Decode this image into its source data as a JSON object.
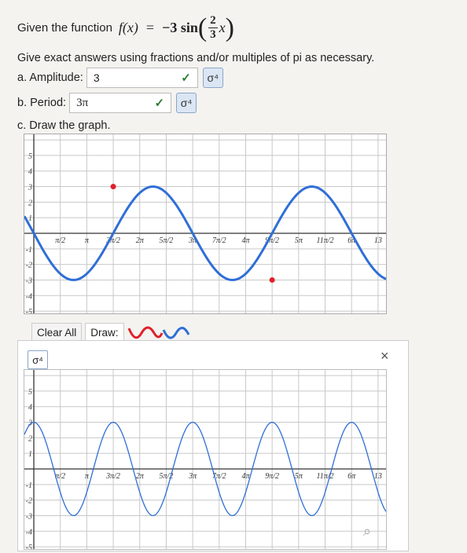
{
  "question": {
    "prefix": "Given the function",
    "func_name": "f(x)",
    "equals": "=",
    "coeff": "−3 sin",
    "frac_num": "2",
    "frac_den": "3",
    "var": "x",
    "lparen": "(",
    "rparen": ")"
  },
  "instructions": "Give exact answers using fractions and/or multiples of pi as necessary.",
  "amplitude": {
    "label": "a. Amplitude:",
    "value": "3",
    "check": "✓"
  },
  "period": {
    "label": "b. Period:",
    "value": "3π",
    "check": "✓"
  },
  "part_c_label": "c. Draw the graph.",
  "graph": {
    "x_tick_labels": [
      "π/2",
      "π",
      "3π/2",
      "2π",
      "5π/2",
      "3π",
      "7π/2",
      "4π",
      "9π/2",
      "5π",
      "11π/2",
      "6π",
      "13"
    ],
    "y_tick_labels": [
      "5",
      "4",
      "3",
      "2",
      "1",
      "-1",
      "-2",
      "-3",
      "-4",
      "-5"
    ],
    "curve_color": "#2f6fd6",
    "point_color": "#e0202a"
  },
  "toolbar": {
    "clear_label": "Clear All",
    "draw_label": "Draw:"
  },
  "panel": {
    "close": "×",
    "key_icon": "σ⁴",
    "magnify_icon": "⌕"
  }
}
